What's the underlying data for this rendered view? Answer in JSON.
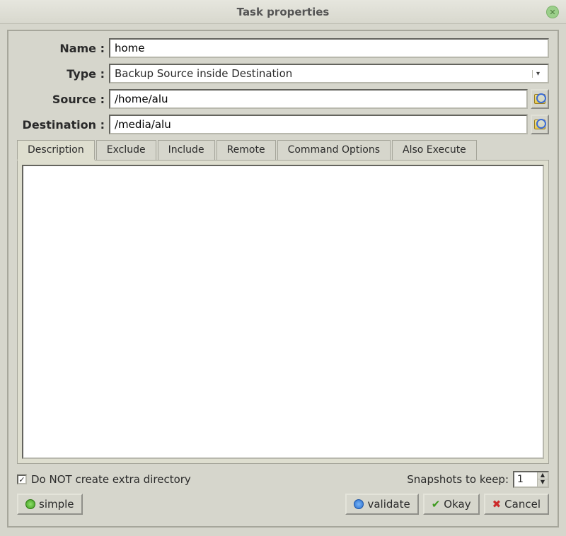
{
  "window": {
    "title": "Task properties"
  },
  "form": {
    "name_label": "Name :",
    "name_value": "home",
    "type_label": "Type :",
    "type_value": "Backup Source inside Destination",
    "source_label": "Source :",
    "source_value": "/home/alu",
    "dest_label": "Destination :",
    "dest_value": "/media/alu"
  },
  "tabs": {
    "items": [
      {
        "label": "Description"
      },
      {
        "label": "Exclude"
      },
      {
        "label": "Include"
      },
      {
        "label": "Remote"
      },
      {
        "label": "Command Options"
      },
      {
        "label": "Also Execute"
      }
    ],
    "description_text": ""
  },
  "options": {
    "no_extra_dir_label": "Do NOT create extra directory",
    "no_extra_dir_checked": "✓",
    "snapshots_label": "Snapshots to keep:",
    "snapshots_value": "1"
  },
  "buttons": {
    "simple": "simple",
    "validate": "validate",
    "okay": "Okay",
    "cancel": "Cancel"
  }
}
